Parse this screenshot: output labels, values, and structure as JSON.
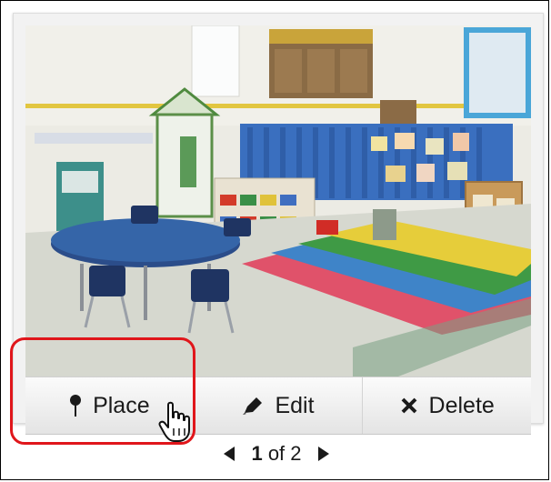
{
  "card": {
    "actions": [
      {
        "label": "Place",
        "icon": "pushpin-icon"
      },
      {
        "label": "Edit",
        "icon": "pencil-icon"
      },
      {
        "label": "Delete",
        "icon": "x-icon"
      }
    ]
  },
  "pager": {
    "current": "1",
    "separator": "of",
    "total": "2"
  },
  "colors": {
    "highlight": "#e0161b",
    "button_text": "#1a1a1a"
  }
}
